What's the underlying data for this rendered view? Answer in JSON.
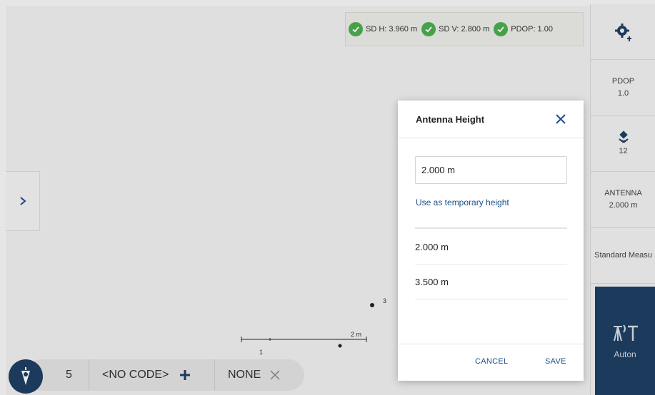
{
  "status": {
    "items": [
      {
        "label": "SD H: 3.960 m",
        "icon": "check-circle-icon"
      },
      {
        "label": "SD V: 2.800 m",
        "icon": "check-circle-icon"
      },
      {
        "label": "PDOP: 1.00",
        "icon": "check-circle-icon"
      }
    ],
    "ok_color": "#4caf50"
  },
  "right_panel": {
    "pdop_label": "PDOP",
    "pdop_value": "1.0",
    "satellites_value": "12",
    "antenna_label": "ANTENNA",
    "antenna_value": "2.000 m",
    "method_label": "Standard Measu",
    "measure_label": "Auton"
  },
  "map": {
    "point_label": "3",
    "scale_label": "2 m",
    "point_label_1": "1"
  },
  "bottom_bar": {
    "point_number": "5",
    "code": "<NO CODE>",
    "layer": "NONE"
  },
  "dialog": {
    "title": "Antenna Height",
    "input_value": "2.000 m",
    "temporary_link": "Use as temporary height",
    "options": [
      "2.000 m",
      "3.500 m"
    ],
    "cancel_label": "CANCEL",
    "save_label": "SAVE"
  },
  "colors": {
    "primary": "#1f3f63",
    "accent": "#1b4f8a"
  }
}
